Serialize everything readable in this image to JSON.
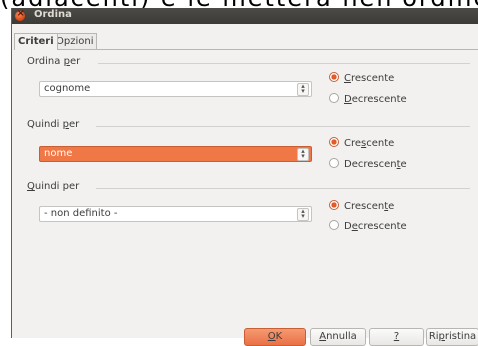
{
  "background_text": "(adiacenti) e le metterà nell'ordine",
  "window": {
    "title": "Ordina"
  },
  "tabs": [
    {
      "label": "Criteri",
      "active": true
    },
    {
      "label": "Opzioni",
      "active": false
    }
  ],
  "groups": [
    {
      "label_pre": "Ordina ",
      "label_key": "p",
      "label_post": "er",
      "selected": "cognome",
      "highlighted": false,
      "ascending": {
        "pre": "",
        "key": "C",
        "post": "rescente",
        "checked": true
      },
      "descending": {
        "pre": "",
        "key": "D",
        "post": "ecrescente",
        "checked": false
      }
    },
    {
      "label_pre": "Quindi ",
      "label_key": "p",
      "label_post": "er",
      "selected": "nome",
      "highlighted": true,
      "ascending": {
        "pre": "Cre",
        "key": "s",
        "post": "cente",
        "checked": true
      },
      "descending": {
        "pre": "Decrescen",
        "key": "t",
        "post": "e",
        "checked": false
      }
    },
    {
      "label_pre": "",
      "label_key": "Q",
      "label_post": "uindi per",
      "selected": "- non definito -",
      "highlighted": false,
      "ascending": {
        "pre": "Crescen",
        "key": "t",
        "post": "e",
        "checked": true
      },
      "descending": {
        "pre": "D",
        "key": "e",
        "post": "crescente",
        "checked": false
      }
    }
  ],
  "buttons": {
    "ok": {
      "pre": "",
      "key": "O",
      "post": "K"
    },
    "cancel": {
      "pre": "",
      "key": "A",
      "post": "nnulla"
    },
    "help": {
      "pre": "",
      "key": "?",
      "post": ""
    },
    "reset": {
      "pre": "Ri",
      "key": "p",
      "post": "ristina"
    }
  },
  "colors": {
    "accent": "#f07746",
    "titlebar": "#3c3b37"
  }
}
